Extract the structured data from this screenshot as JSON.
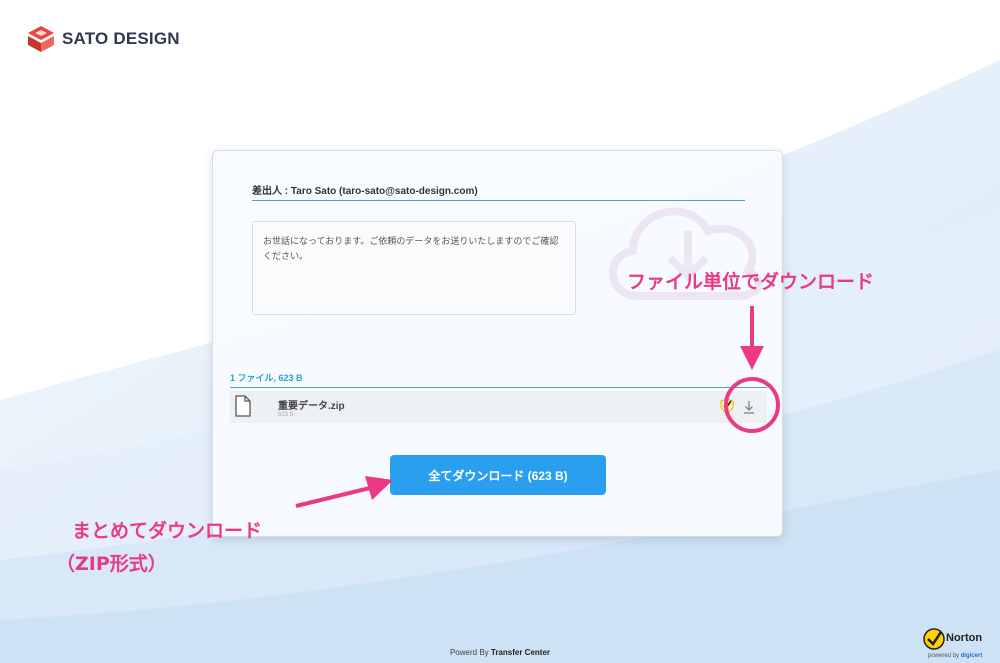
{
  "brand": {
    "name": "SATO DESIGN",
    "accent": "#e8453c"
  },
  "card": {
    "sender": "差出人 : Taro Sato (taro-sato@sato-design.com)",
    "message": "お世話になっております。ご依頼のデータをお送りいたしますのでご確認ください。",
    "file_count": "1 ファイル, 623 B",
    "files": [
      {
        "name": "重要データ.zip",
        "size": "623 B",
        "icon": "file-icon"
      }
    ],
    "download_all_label": "全てダウンロード (623 B)"
  },
  "annotations": {
    "file_download": "ファイル単位でダウンロード",
    "all_download_line1": "まとめてダウンロード",
    "all_download_line2": "（ZIP形式）",
    "color": "#ea3a84"
  },
  "footer": {
    "prefix": "Powerd By ",
    "service": "Transfer Center"
  },
  "norton": {
    "name": "Norton",
    "sub_prefix": "powered by ",
    "sub_brand": "digicert"
  },
  "colors": {
    "primary": "#2a9ff0",
    "line": "#4aa6da",
    "annotation": "#ea3a84"
  }
}
